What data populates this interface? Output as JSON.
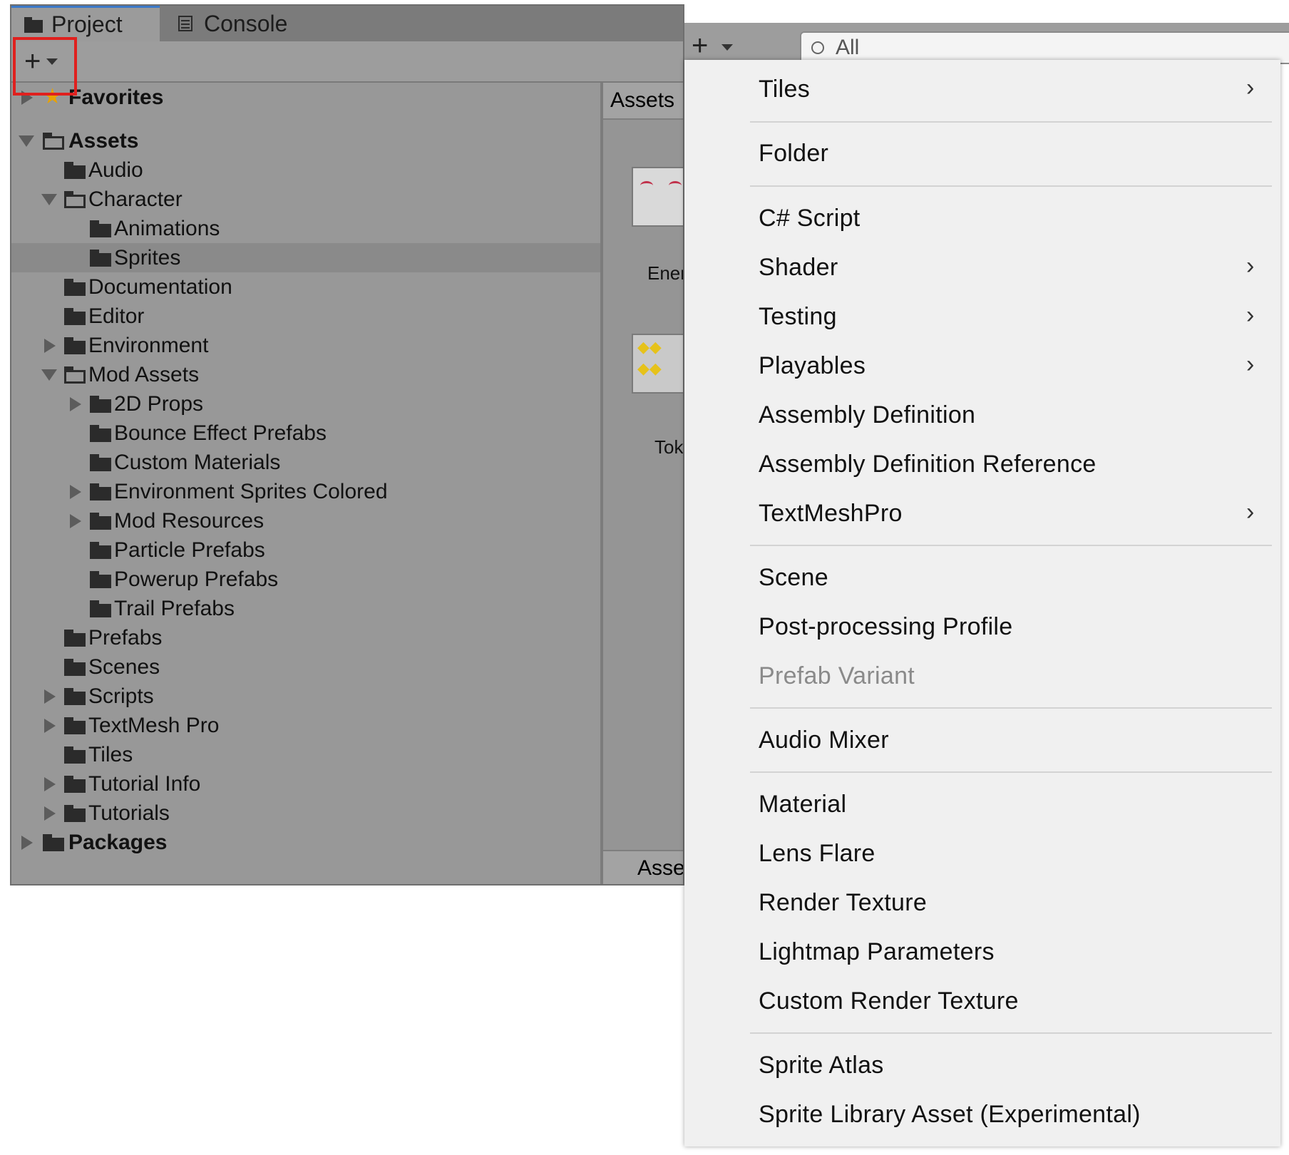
{
  "tabs": {
    "project": "Project",
    "console": "Console"
  },
  "toolbar": {
    "plus": "+"
  },
  "tree": {
    "favorites": "Favorites",
    "assets": "Assets",
    "items": {
      "audio": "Audio",
      "character": "Character",
      "animations": "Animations",
      "sprites": "Sprites",
      "documentation": "Documentation",
      "editor": "Editor",
      "environment": "Environment",
      "mod_assets": "Mod Assets",
      "props_2d": "2D Props",
      "bounce": "Bounce Effect Prefabs",
      "custom_materials": "Custom Materials",
      "env_sprites": "Environment Sprites Colored",
      "mod_resources": "Mod Resources",
      "particle": "Particle Prefabs",
      "powerup": "Powerup Prefabs",
      "trail": "Trail Prefabs",
      "prefabs": "Prefabs",
      "scenes": "Scenes",
      "scripts": "Scripts",
      "textmesh": "TextMesh Pro",
      "tiles": "Tiles",
      "tutorial_info": "Tutorial Info",
      "tutorials": "Tutorials"
    },
    "packages": "Packages"
  },
  "right_pane": {
    "header": "Assets",
    "thumb1_label": "Enem",
    "thumb2_label": "Toke",
    "bottom": "Asse"
  },
  "search": {
    "placeholder": "All"
  },
  "menu": {
    "tiles": "Tiles",
    "folder": "Folder",
    "csharp": "C# Script",
    "shader": "Shader",
    "testing": "Testing",
    "playables": "Playables",
    "asmdef": "Assembly Definition",
    "asmref": "Assembly Definition Reference",
    "tmp": "TextMeshPro",
    "scene": "Scene",
    "ppprofile": "Post-processing Profile",
    "prefab_variant": "Prefab Variant",
    "audio_mixer": "Audio Mixer",
    "material": "Material",
    "lens_flare": "Lens Flare",
    "render_texture": "Render Texture",
    "lightmap": "Lightmap Parameters",
    "custom_rt": "Custom Render Texture",
    "sprite_atlas": "Sprite Atlas",
    "sprite_library": "Sprite Library Asset (Experimental)",
    "chevron": "›"
  },
  "colors": {
    "highlight": "#e0201e",
    "tab_accent": "#3a79c9"
  }
}
